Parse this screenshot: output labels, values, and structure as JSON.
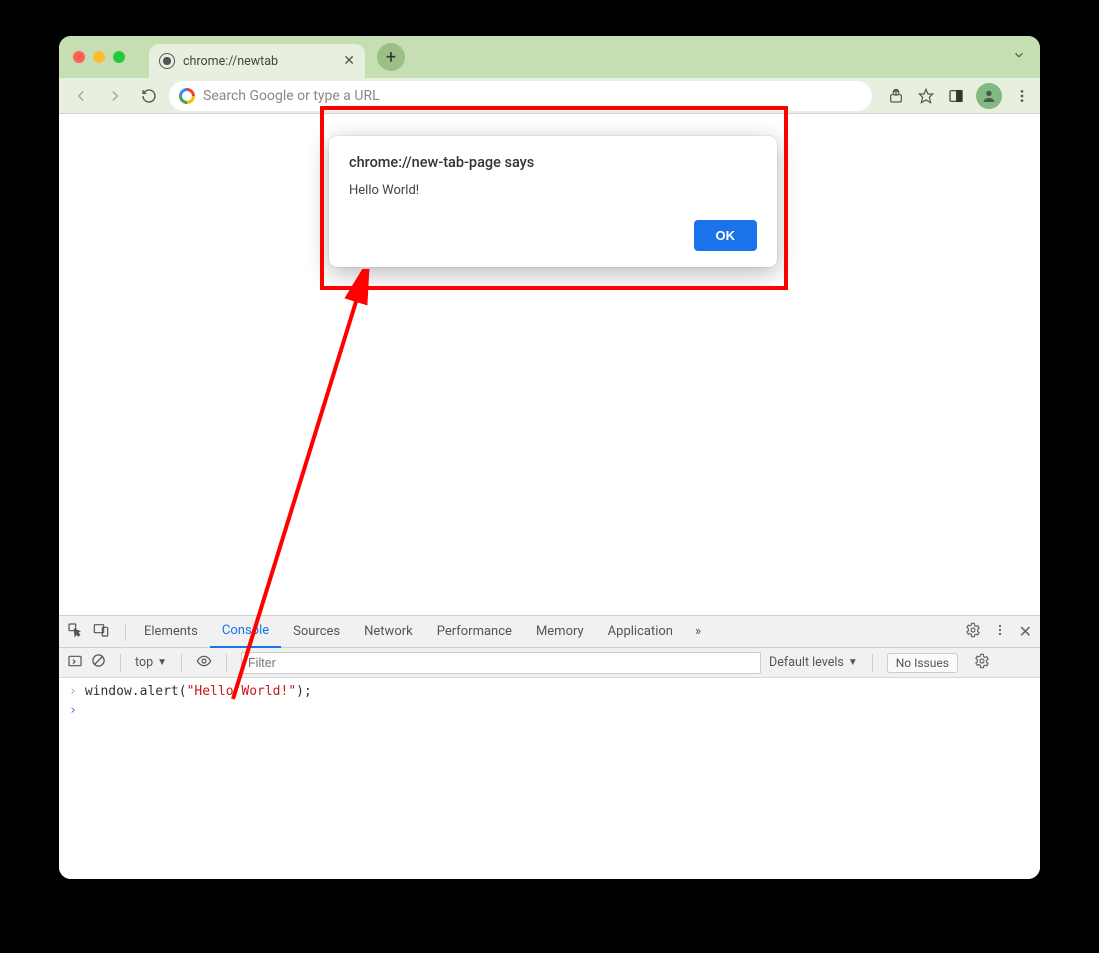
{
  "tab": {
    "title": "chrome://newtab"
  },
  "omnibox": {
    "placeholder": "Search Google or type a URL"
  },
  "alert": {
    "title": "chrome://new-tab-page says",
    "message": "Hello World!",
    "ok_label": "OK"
  },
  "devtools": {
    "tabs": [
      "Elements",
      "Console",
      "Sources",
      "Network",
      "Performance",
      "Memory",
      "Application"
    ],
    "active_tab": "Console",
    "context_label": "top",
    "filter_placeholder": "Filter",
    "levels_label": "Default levels",
    "no_issues_label": "No Issues"
  },
  "console": {
    "code_prefix": "window.alert(",
    "code_string": "\"Hello World!\"",
    "code_suffix": ");"
  }
}
